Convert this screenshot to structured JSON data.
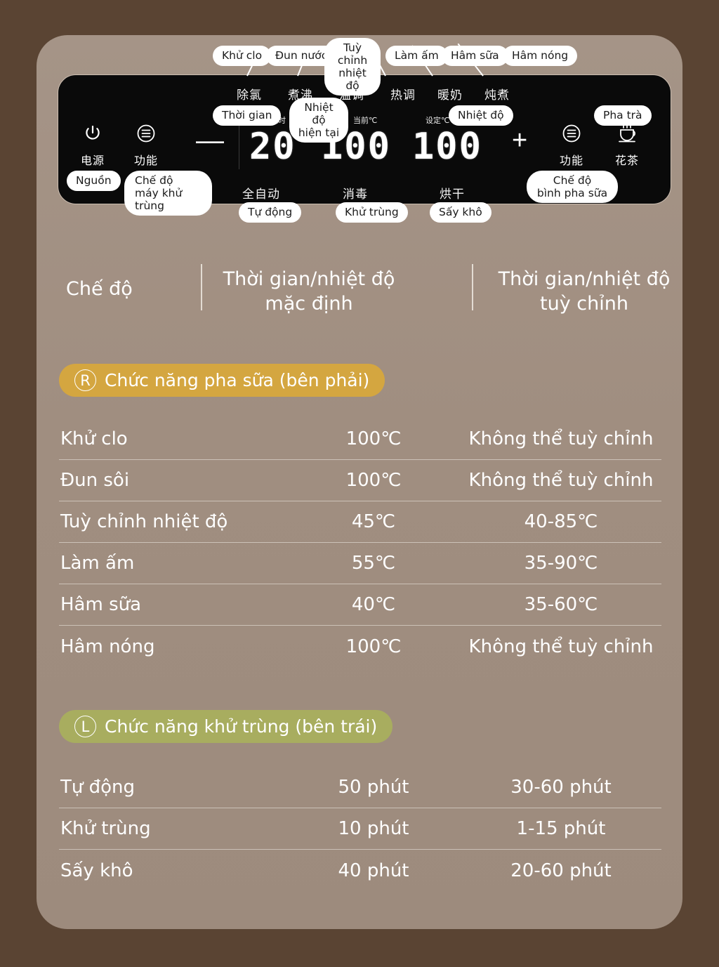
{
  "colors": {
    "outer_frame": "#5a4433",
    "inner_panel": "#a3927f",
    "control_panel": "#0a0a0a",
    "badge_right": "#d4a640",
    "badge_left": "#a8ad5f",
    "text_white": "#ffffff"
  },
  "control_panel": {
    "mode_labels_cn": [
      "除氯",
      "煮沸",
      "温调",
      "热调",
      "暖奶",
      "炖煮"
    ],
    "function_labels_cn": [
      "全自动",
      "消毒",
      "烘干"
    ],
    "tiny_labels_cn": [
      "定时",
      "当前℃",
      "设定℃"
    ],
    "power": {
      "label_cn": "电源",
      "icon": "power-icon"
    },
    "function_left": {
      "label_cn": "功能",
      "icon": "menu-lines-icon"
    },
    "function_right": {
      "label_cn": "功能",
      "icon": "menu-lines-icon"
    },
    "tea": {
      "label_cn": "花茶",
      "icon": "tea-cup-icon"
    },
    "minus": "—",
    "plus": "+",
    "display": {
      "timer": "20",
      "current_temp": "100",
      "set_temp": "100"
    }
  },
  "callouts": {
    "top": [
      {
        "text": "Khử clo"
      },
      {
        "text": "Đun nước"
      },
      {
        "text": "Tuỳ chỉnh\nnhiệt độ"
      },
      {
        "text": "Làm ấm"
      },
      {
        "text": "Hâm sữa"
      },
      {
        "text": "Hâm nóng"
      }
    ],
    "mid": [
      {
        "text": "Thời gian"
      },
      {
        "text": "Nhiệt độ\nhiện tại"
      },
      {
        "text": "Nhiệt độ"
      },
      {
        "text": "Pha trà"
      }
    ],
    "lower": [
      {
        "text": "Nguồn"
      },
      {
        "text": "Chế độ\nmáy khử trùng"
      },
      {
        "text": "Chế độ\nbình pha sữa"
      }
    ],
    "bottom": [
      {
        "text": "Tự động"
      },
      {
        "text": "Khử trùng"
      },
      {
        "text": "Sấy khô"
      }
    ]
  },
  "table": {
    "headers": {
      "mode": "Chế độ",
      "default": "Thời gian/nhiệt độ\nmặc định",
      "custom": "Thời gian/nhiệt độ\ntuỳ chỉnh"
    },
    "sections": [
      {
        "badge_letter": "R",
        "badge_text": "Chức năng pha sữa (bên phải)",
        "badge_color": "#d4a640",
        "rows": [
          {
            "mode": "Khử clo",
            "default": "100℃",
            "custom": "Không thể tuỳ chỉnh"
          },
          {
            "mode": "Đun sôi",
            "default": "100℃",
            "custom": "Không thể tuỳ chỉnh"
          },
          {
            "mode": "Tuỳ chỉnh nhiệt độ",
            "default": "45℃",
            "custom": "40-85℃"
          },
          {
            "mode": "Làm ấm",
            "default": "55℃",
            "custom": "35-90℃"
          },
          {
            "mode": "Hâm sữa",
            "default": "40℃",
            "custom": "35-60℃"
          },
          {
            "mode": "Hâm nóng",
            "default": "100℃",
            "custom": "Không thể tuỳ chỉnh"
          }
        ]
      },
      {
        "badge_letter": "L",
        "badge_text": "Chức năng khử trùng (bên trái)",
        "badge_color": "#a8ad5f",
        "rows": [
          {
            "mode": "Tự động",
            "default": "50 phút",
            "custom": "30-60 phút"
          },
          {
            "mode": "Khử trùng",
            "default": "10 phút",
            "custom": "1-15 phút"
          },
          {
            "mode": "Sấy khô",
            "default": "40 phút",
            "custom": "20-60 phút"
          }
        ]
      }
    ]
  }
}
